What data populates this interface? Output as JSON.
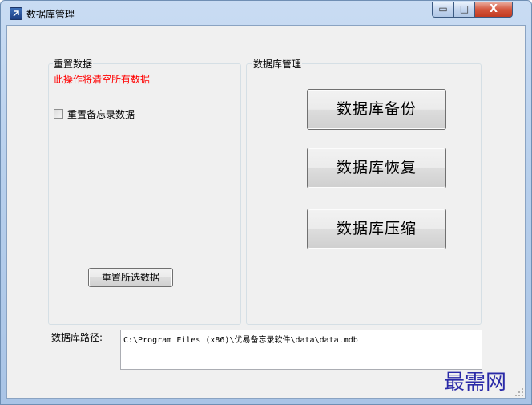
{
  "window": {
    "title": "数据库管理",
    "minimize_glyph": "▭",
    "maximize_glyph": "□",
    "close_glyph": "X"
  },
  "reset_group": {
    "label": "重置数据",
    "warning": "此操作将清空所有数据",
    "memo_checkbox_label": "重置备忘录数据",
    "memo_checkbox_checked": false,
    "reset_button_label": "重置所选数据"
  },
  "db_group": {
    "label": "数据库管理",
    "backup_button_label": "数据库备份",
    "restore_button_label": "数据库恢复",
    "compress_button_label": "数据库压缩"
  },
  "path": {
    "label": "数据库路径:",
    "value": "C:\\Program Files (x86)\\优易备忘录软件\\data\\data.mdb"
  },
  "watermark": "最需网",
  "colors": {
    "warning": "#ff0000",
    "watermark": "#2a2aa8",
    "window_frame": "#b7cfec",
    "close_button": "#d4553c"
  }
}
